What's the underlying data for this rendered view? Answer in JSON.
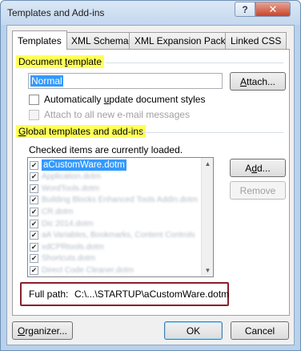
{
  "window": {
    "title": "Templates and Add-ins",
    "help_glyph": "?",
    "close_glyph": "✕"
  },
  "tabs": [
    {
      "label": "Templates"
    },
    {
      "label": "XML Schema"
    },
    {
      "label": "XML Expansion Packs"
    },
    {
      "label": "Linked CSS"
    }
  ],
  "document_template": {
    "section_label": "Document template",
    "value": "Normal",
    "attach_label": "Attach...",
    "auto_update_label": "Automatically update document styles",
    "attach_email_label": "Attach to all new e-mail messages"
  },
  "global_templates": {
    "section_label": "Global templates and add-ins",
    "note": "Checked items are currently loaded.",
    "items": [
      {
        "label": "aCustomWare.dotm",
        "checked": true,
        "selected": true
      },
      {
        "label": "",
        "checked": true
      },
      {
        "label": "",
        "checked": true
      },
      {
        "label": "",
        "checked": true
      },
      {
        "label": "",
        "checked": true
      },
      {
        "label": "",
        "checked": true
      },
      {
        "label": "",
        "checked": true
      },
      {
        "label": "",
        "checked": true
      },
      {
        "label": "",
        "checked": true
      },
      {
        "label": "",
        "checked": true
      }
    ],
    "add_label": "Add...",
    "remove_label": "Remove"
  },
  "full_path": {
    "label": "Full path:",
    "value": "C:\\...\\STARTUP\\aCustomWare.dotm"
  },
  "footer": {
    "organizer_label": "Organizer...",
    "ok_label": "OK",
    "cancel_label": "Cancel"
  },
  "colors": {
    "highlight": "#ffff57",
    "selection": "#3399ff",
    "callout_border": "#8a1f2a"
  }
}
